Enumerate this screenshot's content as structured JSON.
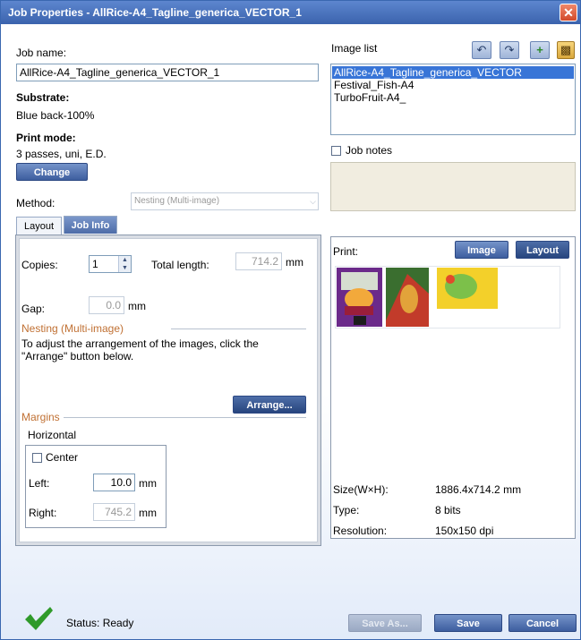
{
  "window": {
    "title": "Job Properties - AllRice-A4_Tagline_generica_VECTOR_1",
    "close_icon": "✕"
  },
  "job": {
    "name_label": "Job name:",
    "name_value": "AllRice-A4_Tagline_generica_VECTOR_1",
    "substrate_label": "Substrate:",
    "substrate_value": "Blue back-100%",
    "print_mode_label": "Print mode:",
    "print_mode_value": "3 passes, uni, E.D.",
    "change_button": "Change",
    "method_label": "Method:",
    "method_value": "Nesting (Multi-image)"
  },
  "tabs": [
    {
      "label": "Layout"
    },
    {
      "label": "Job Info"
    }
  ],
  "layout_tab": {
    "copies_label": "Copies:",
    "copies_value": "1",
    "total_length_label": "Total length:",
    "total_length_value": "714.2",
    "unit": "mm",
    "gap_label": "Gap:",
    "gap_value": "0.0",
    "nesting_heading": "Nesting (Multi-image)",
    "nesting_help": "To adjust the arrangement of the images, click the \"Arrange\" button below.",
    "arrange_button": "Arrange...",
    "margins_heading": "Margins",
    "horizontal_label": "Horizontal",
    "center_label": "Center",
    "left_label": "Left:",
    "left_value": "10.0",
    "right_label": "Right:",
    "right_value": "745.2"
  },
  "image_list": {
    "label": "Image list",
    "items": [
      {
        "name": "AllRice-A4_Tagline_generica_VECTOR",
        "selected": true
      },
      {
        "name": "Festival_Fish-A4",
        "selected": false
      },
      {
        "name": "TurboFruit-A4_",
        "selected": false
      }
    ],
    "toolbar_icons": [
      "undo-icon",
      "redo-icon",
      "add-image-icon",
      "trash-icon"
    ]
  },
  "job_notes": {
    "label": "Job notes",
    "value": ""
  },
  "preview": {
    "print_label": "Print:",
    "image_button": "Image",
    "layout_button": "Layout",
    "size_label": "Size(W×H):",
    "size_value": "1886.4x714.2 mm",
    "type_label": "Type:",
    "type_value": "8 bits",
    "resolution_label": "Resolution:",
    "resolution_value": "150x150 dpi"
  },
  "footer": {
    "status_text": "Status: Ready",
    "save_as_button": "Save As...",
    "save_button": "Save",
    "cancel_button": "Cancel"
  },
  "colors": {
    "titlebar": "#3b63ad",
    "button": "#4e6ea8",
    "selection": "#3875d7",
    "status_ok": "#2f9a2a",
    "section_heading": "#c07033"
  }
}
